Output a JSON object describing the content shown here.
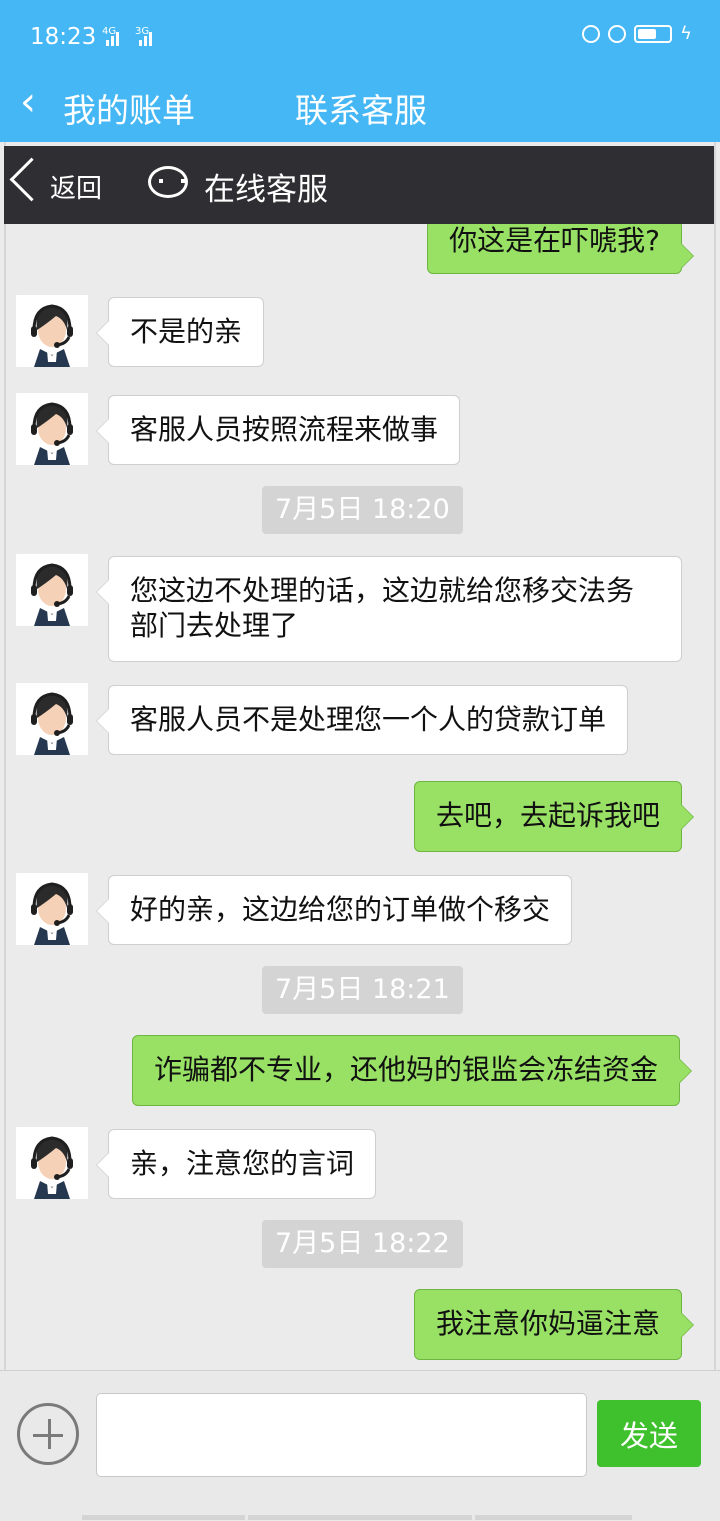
{
  "status_bar": {
    "time": "18:23",
    "net1": "4G",
    "net2": "3G"
  },
  "app_bar": {
    "back_label": "我的账单",
    "service_label": "联系客服"
  },
  "chat_header": {
    "back_label": "返回",
    "title": "在线客服"
  },
  "messages": [
    {
      "side": "right",
      "text": "你这是在吓唬我?"
    },
    {
      "side": "left",
      "text": "不是的亲"
    },
    {
      "side": "left",
      "text": "客服人员按照流程来做事"
    },
    {
      "side": "time",
      "text": "7月5日 18:20"
    },
    {
      "side": "left",
      "text": "您这边不处理的话，这边就给您移交法务部门去处理了"
    },
    {
      "side": "left",
      "text": "客服人员不是处理您一个人的贷款订单"
    },
    {
      "side": "right",
      "text": "去吧，去起诉我吧"
    },
    {
      "side": "left",
      "text": "好的亲，这边给您的订单做个移交"
    },
    {
      "side": "time",
      "text": "7月5日 18:21"
    },
    {
      "side": "right",
      "text": "诈骗都不专业，还他妈的银监会冻结资金"
    },
    {
      "side": "left",
      "text": "亲，注意您的言词"
    },
    {
      "side": "time",
      "text": "7月5日 18:22"
    },
    {
      "side": "right",
      "text": "我注意你妈逼注意"
    }
  ],
  "composer": {
    "input_value": "",
    "send_label": "发送"
  },
  "colors": {
    "brand": "#45b7f5",
    "header_dark": "#2f2f33",
    "right_bubble": "#98e165",
    "send_button": "#3ec12c"
  }
}
